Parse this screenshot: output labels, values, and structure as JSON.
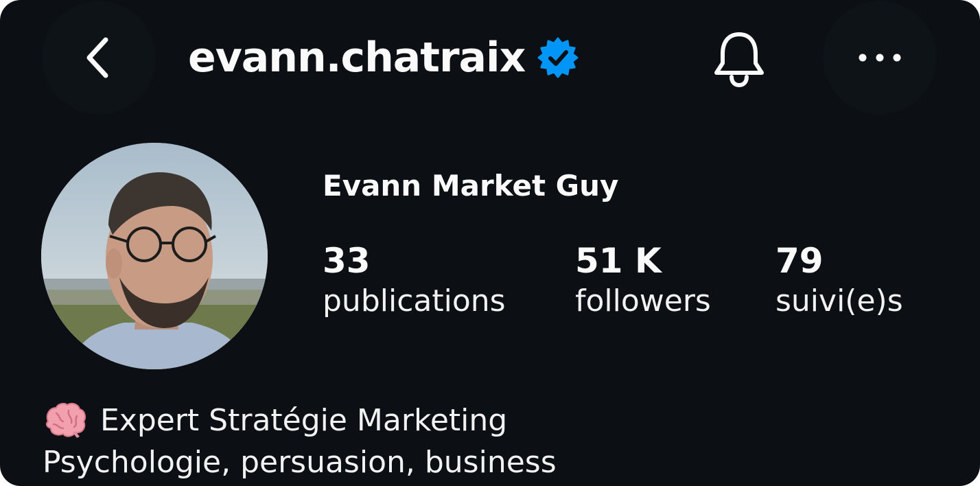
{
  "header": {
    "username": "evann.chatraix",
    "verified": true,
    "icons": {
      "back": "chevron-left-icon",
      "verified": "verified-badge-icon",
      "notifications": "bell-icon",
      "more": "more-horizontal-icon"
    }
  },
  "profile": {
    "display_name": "Evann Market Guy",
    "stats": [
      {
        "value": "33",
        "label": "publications"
      },
      {
        "value": "51 K",
        "label": "followers"
      },
      {
        "value": "79",
        "label": "suivi(e)s"
      }
    ]
  },
  "bio": {
    "emoji": "🧠",
    "line1": "Expert Stratégie Marketing",
    "line2": "Psychologie, persuasion, business"
  },
  "colors": {
    "background": "#0c1014",
    "text": "#fafafa",
    "verified_blue": "#0095f6"
  }
}
